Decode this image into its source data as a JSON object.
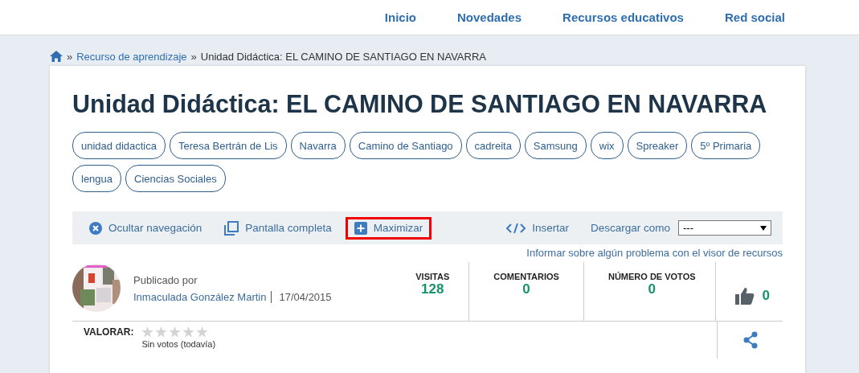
{
  "nav": [
    {
      "label": "Inicio"
    },
    {
      "label": "Novedades"
    },
    {
      "label": "Recursos educativos"
    },
    {
      "label": "Red social"
    }
  ],
  "breadcrumb": {
    "link": "Recurso de aprendizaje",
    "separator": "»",
    "current": "Unidad Didáctica: EL CAMINO DE SANTIAGO EN NAVARRA"
  },
  "title": "Unidad Didáctica: EL CAMINO DE SANTIAGO EN NAVARRA",
  "tags": [
    "unidad didactica",
    "Teresa Bertrán de Lis",
    "Navarra",
    "Camino de Santiago",
    "cadreita",
    "Samsung",
    "wix",
    "Spreaker",
    "5º Primaria",
    "lengua",
    "Ciencias Sociales"
  ],
  "toolbar": {
    "left": [
      {
        "kind": "close",
        "label": "Ocultar navegación",
        "highlighted": false
      },
      {
        "kind": "fullscreen",
        "label": "Pantalla completa",
        "highlighted": false
      },
      {
        "kind": "maximize",
        "label": "Maximizar",
        "highlighted": true
      }
    ],
    "embed": "Insertar",
    "download_label": "Descargar como",
    "download_value": "---"
  },
  "report_link": "Informar sobre algún problema con el visor de recursos",
  "author": {
    "published_by": "Publicado por",
    "name": "Inmaculada González Martin",
    "date": "17/04/2015"
  },
  "stats": [
    {
      "label": "VISITAS",
      "value": "128"
    },
    {
      "label": "COMENTARIOS",
      "value": "0"
    },
    {
      "label": "NÚMERO DE VOTOS",
      "value": "0"
    }
  ],
  "likes": "0",
  "rating": {
    "label": "VALORAR:",
    "stars": 0,
    "note": "Sin votos (todavía)"
  }
}
